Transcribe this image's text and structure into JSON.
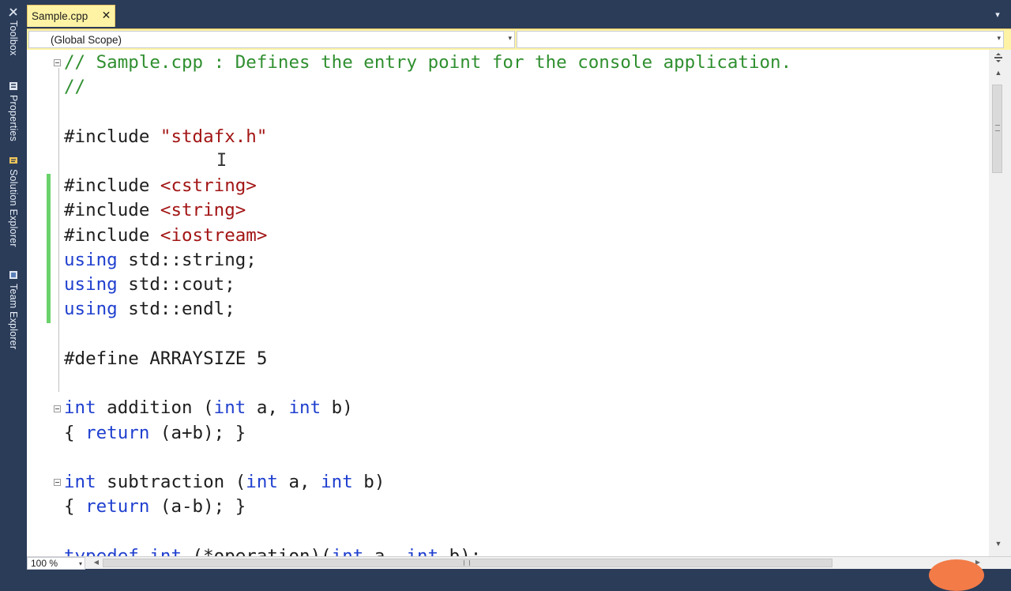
{
  "side_rail": {
    "items": [
      {
        "label": "Toolbox",
        "icon": "toolbox-icon"
      },
      {
        "label": "Properties",
        "icon": "properties-icon"
      },
      {
        "label": "Solution Explorer",
        "icon": "solution-explorer-icon"
      },
      {
        "label": "Team Explorer",
        "icon": "team-explorer-icon"
      }
    ]
  },
  "tabs": [
    {
      "title": "Sample.cpp",
      "active": true,
      "close_glyph": "✕"
    }
  ],
  "tab_dropdown_glyph": "▾",
  "nav_bar": {
    "scope_combo": "(Global Scope)",
    "member_combo": "",
    "arrow_glyph": "▾"
  },
  "editor": {
    "cursor_glyph": "I",
    "lines": [
      {
        "tokens": [
          {
            "t": "// Sample.cpp : Defines the entry point for the console application.",
            "k": "comment"
          }
        ]
      },
      {
        "tokens": [
          {
            "t": "//",
            "k": "comment"
          }
        ]
      },
      {
        "tokens": [
          {
            "t": "#include ",
            "k": "pre"
          },
          {
            "t": "\"stdafx.h\"",
            "k": "string"
          }
        ]
      },
      {
        "tokens": [
          {
            "t": "#include ",
            "k": "pre"
          },
          {
            "t": "<cstring>",
            "k": "string"
          }
        ]
      },
      {
        "tokens": [
          {
            "t": "#include ",
            "k": "pre"
          },
          {
            "t": "<string>",
            "k": "string"
          }
        ]
      },
      {
        "tokens": [
          {
            "t": "#include ",
            "k": "pre"
          },
          {
            "t": "<iostream>",
            "k": "string"
          }
        ]
      },
      {
        "tokens": [
          {
            "t": "using",
            "k": "keyword"
          },
          {
            "t": " std::string;",
            "k": "plain"
          }
        ]
      },
      {
        "tokens": [
          {
            "t": "using",
            "k": "keyword"
          },
          {
            "t": " std::cout;",
            "k": "plain"
          }
        ]
      },
      {
        "tokens": [
          {
            "t": "using",
            "k": "keyword"
          },
          {
            "t": " std::endl;",
            "k": "plain"
          }
        ]
      },
      {
        "tokens": [
          {
            "t": "#define ",
            "k": "pre"
          },
          {
            "t": "ARRAYSIZE 5",
            "k": "plain"
          }
        ]
      },
      {
        "tokens": [
          {
            "t": "int",
            "k": "keyword"
          },
          {
            "t": " addition (",
            "k": "plain"
          },
          {
            "t": "int",
            "k": "keyword"
          },
          {
            "t": " a, ",
            "k": "plain"
          },
          {
            "t": "int",
            "k": "keyword"
          },
          {
            "t": " b)",
            "k": "plain"
          }
        ]
      },
      {
        "tokens": [
          {
            "t": "{ ",
            "k": "plain"
          },
          {
            "t": "return",
            "k": "keyword"
          },
          {
            "t": " (a+b); }",
            "k": "plain"
          }
        ]
      },
      {
        "tokens": [
          {
            "t": "int",
            "k": "keyword"
          },
          {
            "t": " subtraction (",
            "k": "plain"
          },
          {
            "t": "int",
            "k": "keyword"
          },
          {
            "t": " a, ",
            "k": "plain"
          },
          {
            "t": "int",
            "k": "keyword"
          },
          {
            "t": " b)",
            "k": "plain"
          }
        ]
      },
      {
        "tokens": [
          {
            "t": "{ ",
            "k": "plain"
          },
          {
            "t": "return",
            "k": "keyword"
          },
          {
            "t": " (a-b); }",
            "k": "plain"
          }
        ]
      },
      {
        "tokens": [
          {
            "t": "typedef",
            "k": "keyword"
          },
          {
            "t": " ",
            "k": "plain"
          },
          {
            "t": "int",
            "k": "keyword"
          },
          {
            "t": " (*operation)(",
            "k": "plain"
          },
          {
            "t": "int",
            "k": "keyword"
          },
          {
            "t": " a, ",
            "k": "plain"
          },
          {
            "t": "int",
            "k": "keyword"
          },
          {
            "t": " b);",
            "k": "plain"
          }
        ]
      }
    ]
  },
  "scrollbars": {
    "up_glyph": "▲",
    "down_glyph": "▼",
    "left_glyph": "◀",
    "right_glyph": "▶",
    "vertical_position": 0.0
  },
  "status": {
    "zoom": "100 %",
    "zoom_arrow": "▾"
  },
  "colors": {
    "comment": "#2f8f2f",
    "keyword": "#1f3fcf",
    "string": "#a31515",
    "tab_active_bg": "#fef3a4",
    "chrome_bg": "#2b3c59"
  }
}
